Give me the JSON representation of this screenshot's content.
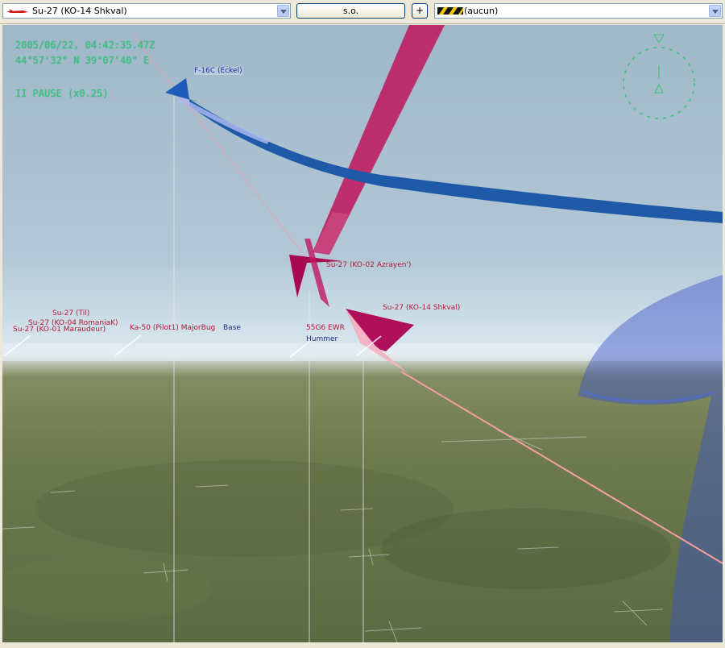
{
  "toolbar": {
    "unit_select": {
      "value": "Su-27 (KO-14 Shkval)",
      "icon": "red-jet-icon"
    },
    "so_button": "s.o.",
    "plus_button": "+",
    "target_select": {
      "value": "(aucun)",
      "icon": "hazard-stripes-icon"
    }
  },
  "hud": {
    "datetime": "2005/06/22, 04:42:35.47Z",
    "coordinates": "44°57'32\" N  39°07'40\" E",
    "pause": "II PAUSE (x0.25)"
  },
  "labels": {
    "f16": "F-16C (Eckel)",
    "su27_azrayen": "Su-27 (KO-02 Azrayen')",
    "su27_shkval": "Su-27 (KO-14 Shkval)",
    "su27_til": "Su-27 (Til)",
    "su27_romaniak": "Su-27 (KO-04 RomaniaK)",
    "su27_maraudeur": "Su-27 (KO-01 Maraudeur)",
    "ka50": "Ka-50 (Pilot1) MajorBug",
    "base": "Base",
    "ewr": "55G6 EWR",
    "hummer": "Hummer"
  },
  "colors": {
    "hud_green": "#3ec47a",
    "own_aircraft": "#a80a50",
    "enemy_trail": "#1e5aa8",
    "window_bg": "#ece9d8"
  }
}
